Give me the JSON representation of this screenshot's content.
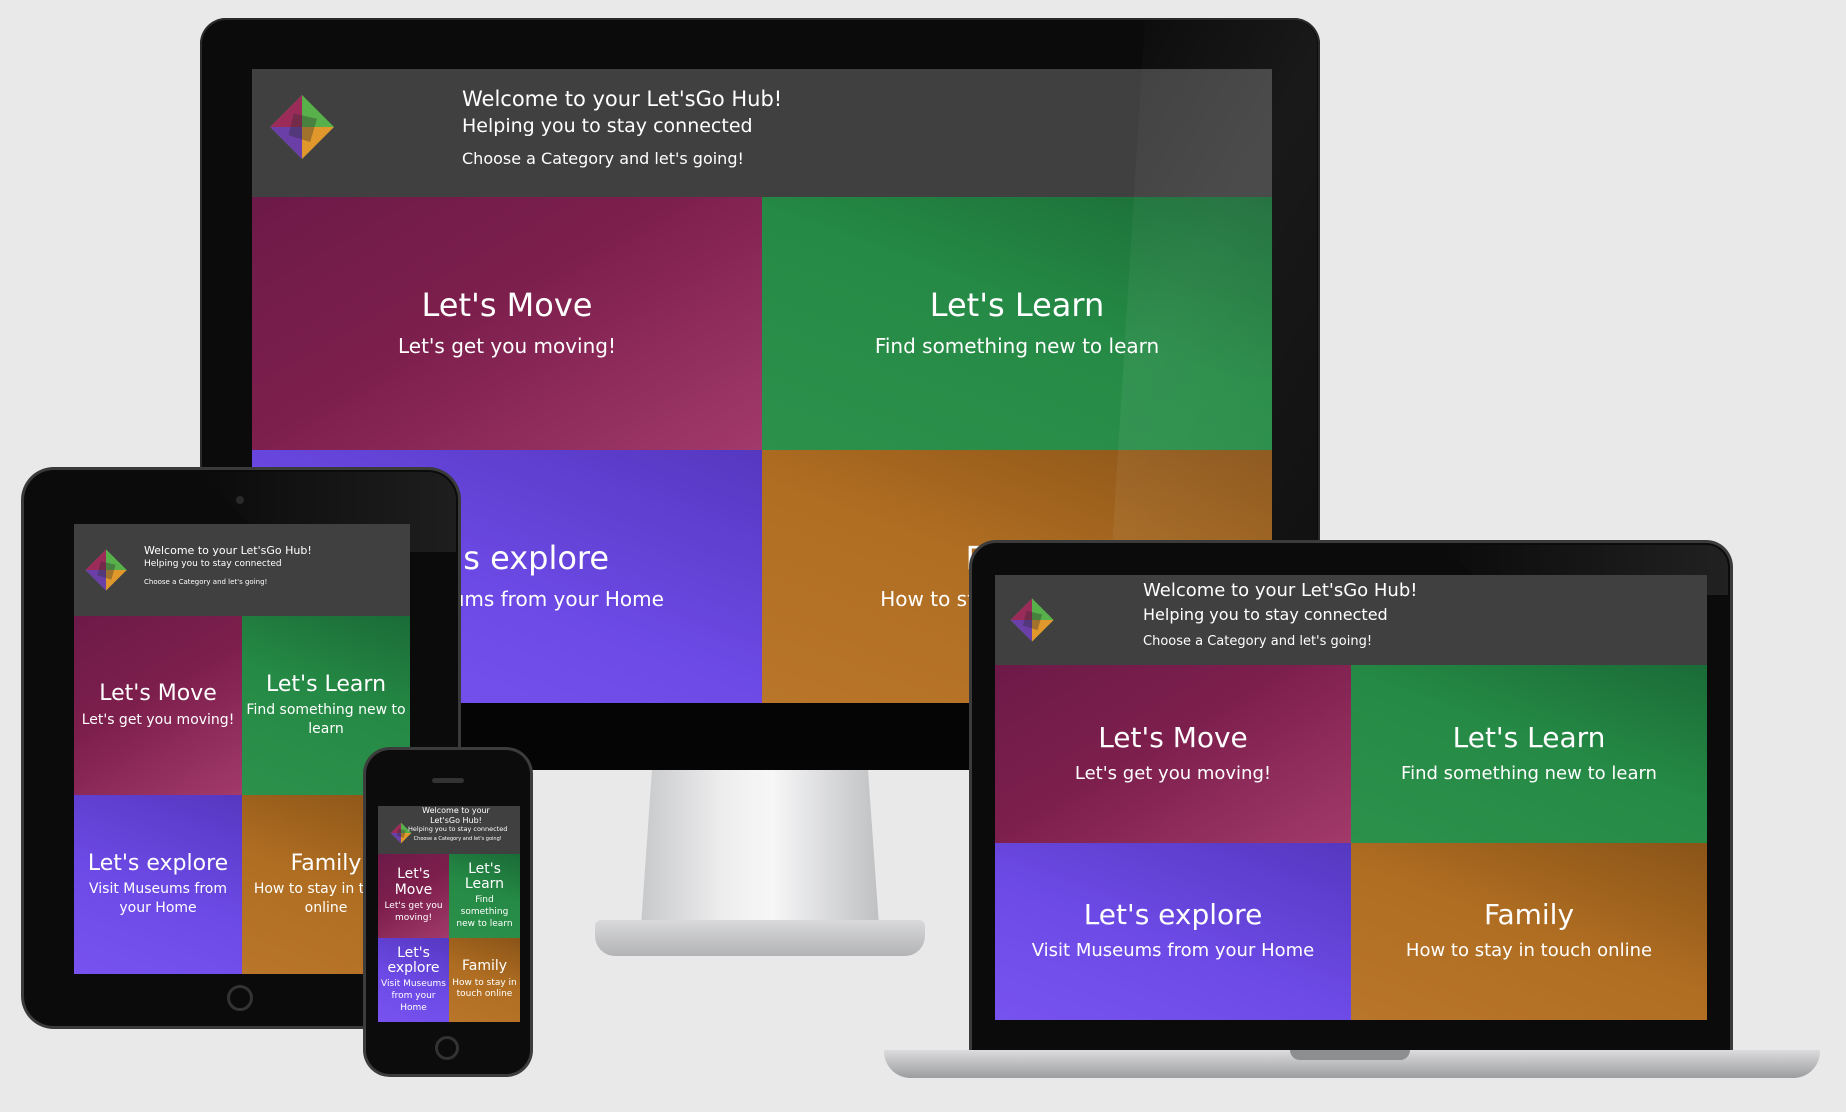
{
  "header": {
    "title": "Welcome to your Let'sGo Hub!",
    "subtitle": "Helping you to stay connected",
    "prompt": "Choose a Category and let's going!"
  },
  "logo_icon": "diamond-logo-icon",
  "categories": [
    {
      "key": "move",
      "title": "Let's Move",
      "subtitle": "Let's get you moving!",
      "color": "#7d1f4d"
    },
    {
      "key": "learn",
      "title": "Let's Learn",
      "subtitle": "Find something new to learn",
      "color": "#258a45"
    },
    {
      "key": "explore",
      "title": "Let's explore",
      "subtitle": "Visit Museums from your Home",
      "color": "#6d4ae6"
    },
    {
      "key": "family",
      "title": "Family",
      "subtitle": "How to stay in touch online",
      "color": "#b06e22"
    }
  ],
  "colors": {
    "background": "#e9e9ea",
    "header": "#404040",
    "bezel": "#0b0b0b"
  }
}
